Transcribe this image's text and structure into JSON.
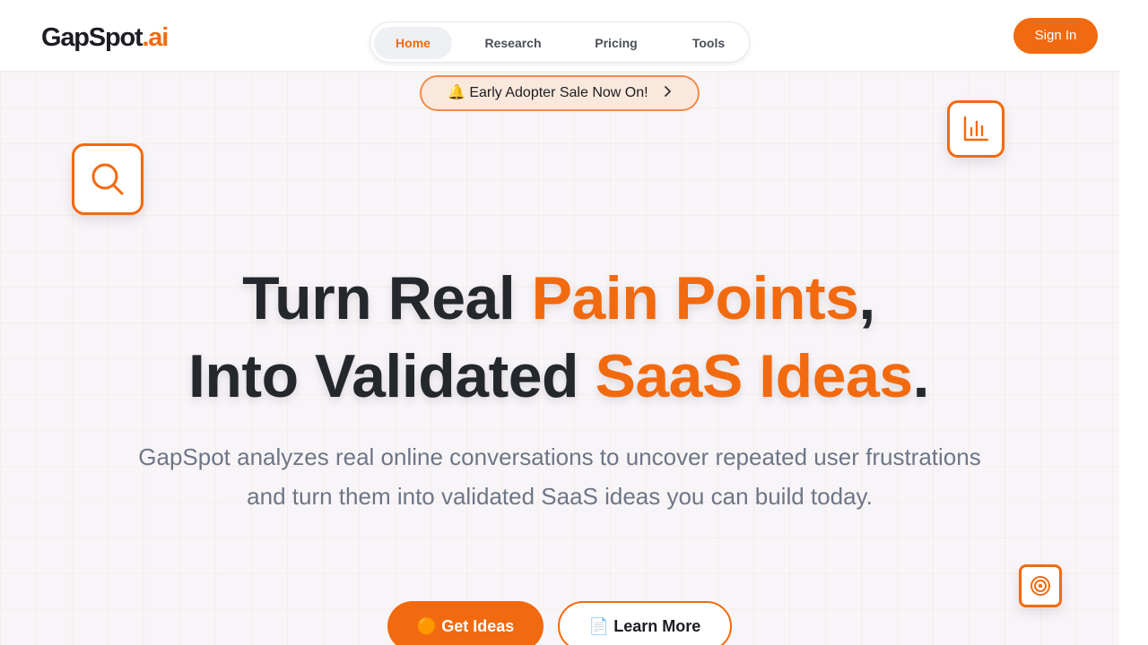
{
  "header": {
    "logo_main": "GapSpot",
    "logo_accent": ".ai",
    "nav": [
      {
        "label": "Home",
        "active": true
      },
      {
        "label": "Research",
        "active": false
      },
      {
        "label": "Pricing",
        "active": false
      },
      {
        "label": "Tools",
        "active": false
      }
    ],
    "signin_label": "Sign In"
  },
  "banner": {
    "icon": "bell-emoji",
    "emoji": "🔔",
    "text": "Early Adopter Sale Now On!",
    "chevron": "›"
  },
  "floating_icons": [
    "search-icon",
    "bar-chart-icon",
    "target-icon"
  ],
  "hero": {
    "line1_part1": "Turn Real ",
    "line1_highlight": "Pain Points",
    "line1_end": ",",
    "line2_part1": "Into Validated ",
    "line2_highlight": "SaaS Ideas",
    "line2_end": ".",
    "subtitle_line1": "GapSpot analyzes real online conversations to uncover repeated user frustrations",
    "subtitle_line2": "and turn them into validated SaaS ideas you can build today."
  },
  "cta": {
    "primary_emoji": "🟠",
    "primary_label": "Get Ideas",
    "secondary_emoji": "📄",
    "secondary_label": "Learn More"
  },
  "colors": {
    "accent": "#f26a0f",
    "text_dark": "#24272c",
    "text_muted": "#6d7685"
  }
}
